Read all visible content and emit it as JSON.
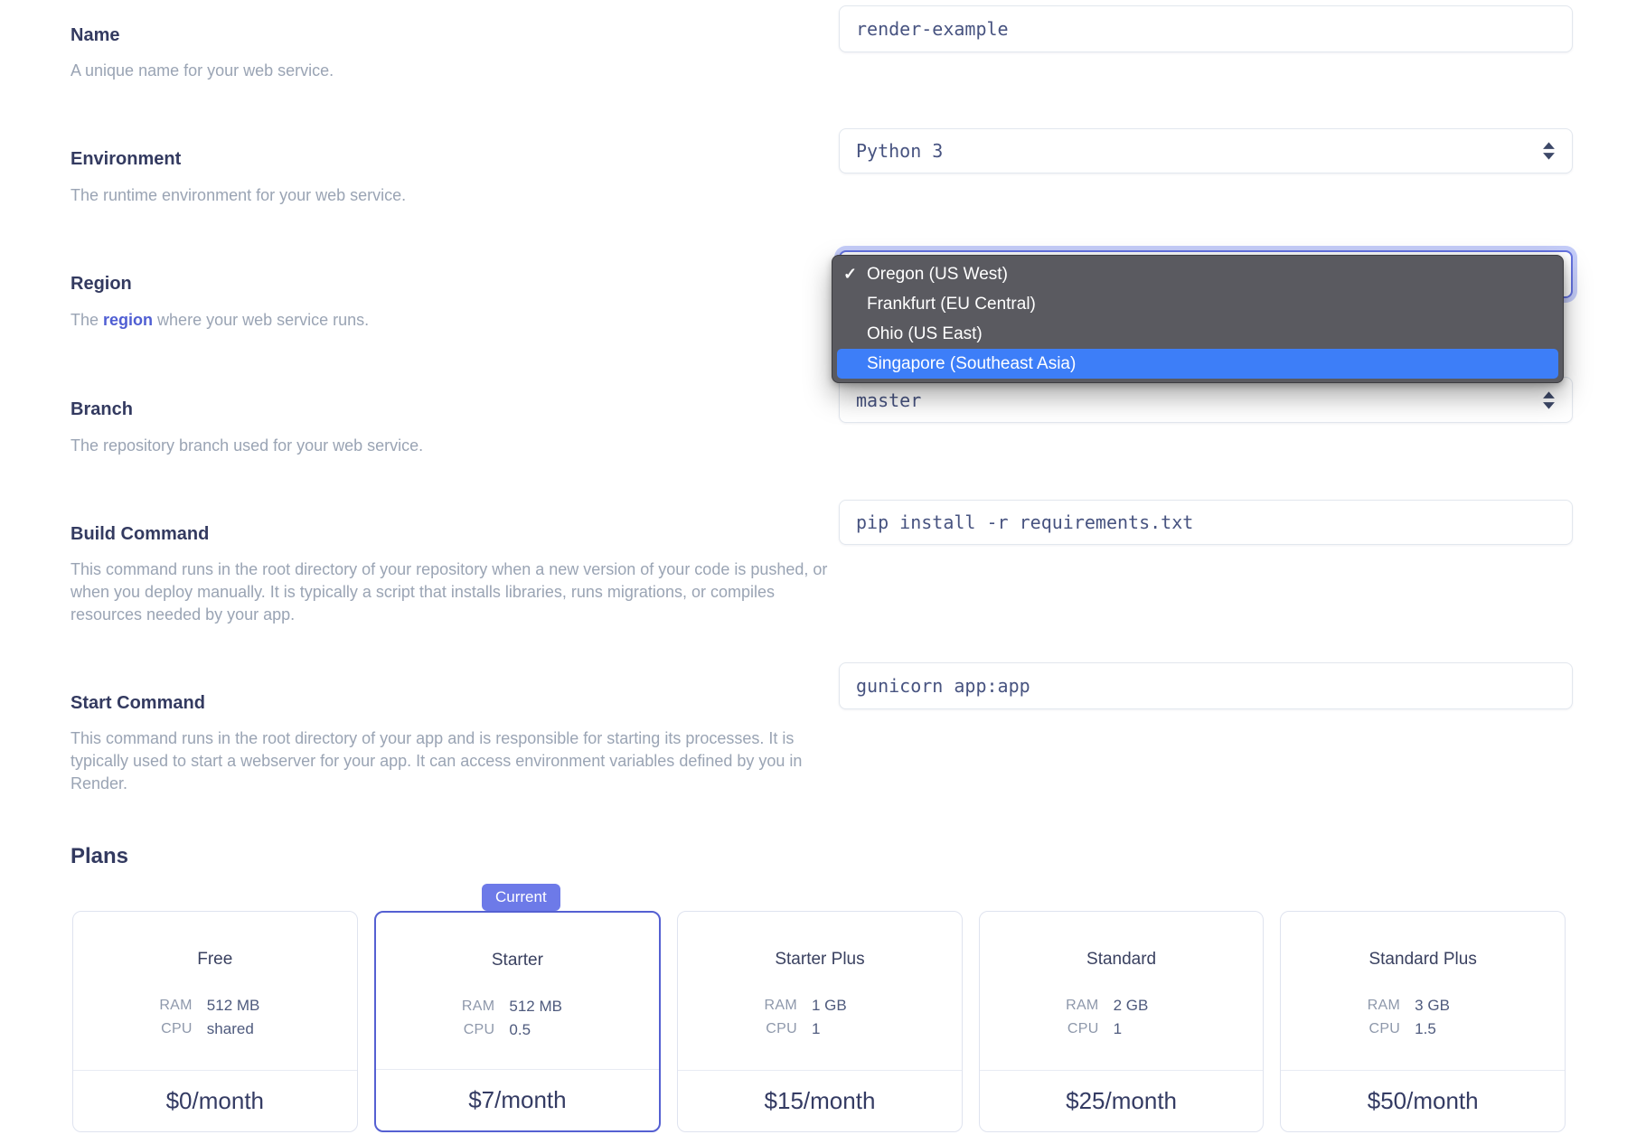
{
  "form": {
    "name": {
      "label": "Name",
      "description": "A unique name for your web service.",
      "value": "render-example"
    },
    "environment": {
      "label": "Environment",
      "description": "The runtime environment for your web service.",
      "value": "Python 3"
    },
    "region": {
      "label": "Region",
      "description_prefix": "The ",
      "description_link": "region",
      "description_suffix": " where your web service runs."
    },
    "branch": {
      "label": "Branch",
      "description": "The repository branch used for your web service.",
      "value": "master"
    },
    "build_command": {
      "label": "Build Command",
      "description": "This command runs in the root directory of your repository when a new version of your code is pushed, or when you deploy manually. It is typically a script that installs libraries, runs migrations, or compiles resources needed by your app.",
      "value": "pip install -r requirements.txt"
    },
    "start_command": {
      "label": "Start Command",
      "description": "This command runs in the root directory of your app and is responsible for starting its processes. It is typically used to start a webserver for your app. It can access environment variables defined by you in Render.",
      "value": "gunicorn app:app"
    }
  },
  "region_dropdown": {
    "checkmark": "✓",
    "options": [
      {
        "label": "Oregon (US West)",
        "selected": true,
        "highlighted": false
      },
      {
        "label": "Frankfurt (EU Central)",
        "selected": false,
        "highlighted": false
      },
      {
        "label": "Ohio (US East)",
        "selected": false,
        "highlighted": false
      },
      {
        "label": "Singapore (Southeast Asia)",
        "selected": false,
        "highlighted": true
      }
    ]
  },
  "plans": {
    "heading": "Plans",
    "current_badge": "Current",
    "ram_label": "RAM",
    "cpu_label": "CPU",
    "cards": [
      {
        "title": "Free",
        "ram": "512 MB",
        "cpu": "shared",
        "price": "$0/month",
        "current": false
      },
      {
        "title": "Starter",
        "ram": "512 MB",
        "cpu": "0.5",
        "price": "$7/month",
        "current": true
      },
      {
        "title": "Starter Plus",
        "ram": "1 GB",
        "cpu": "1",
        "price": "$15/month",
        "current": false
      },
      {
        "title": "Standard",
        "ram": "2 GB",
        "cpu": "1",
        "price": "$25/month",
        "current": false
      },
      {
        "title": "Standard Plus",
        "ram": "3 GB",
        "cpu": "1.5",
        "price": "$50/month",
        "current": false
      }
    ]
  },
  "colors": {
    "accent_border": "#5560d2",
    "badge": "#6d7ae8",
    "selection_blue": "#3d7ef8",
    "dropdown_bg": "#5a5a60",
    "link": "#4f5ed3",
    "label_text": "#333a60",
    "description_text": "#9aa4b4",
    "mono_text": "#475380"
  },
  "icons": {
    "select_stepper": "up-down-arrows",
    "dropdown_check": "checkmark"
  }
}
